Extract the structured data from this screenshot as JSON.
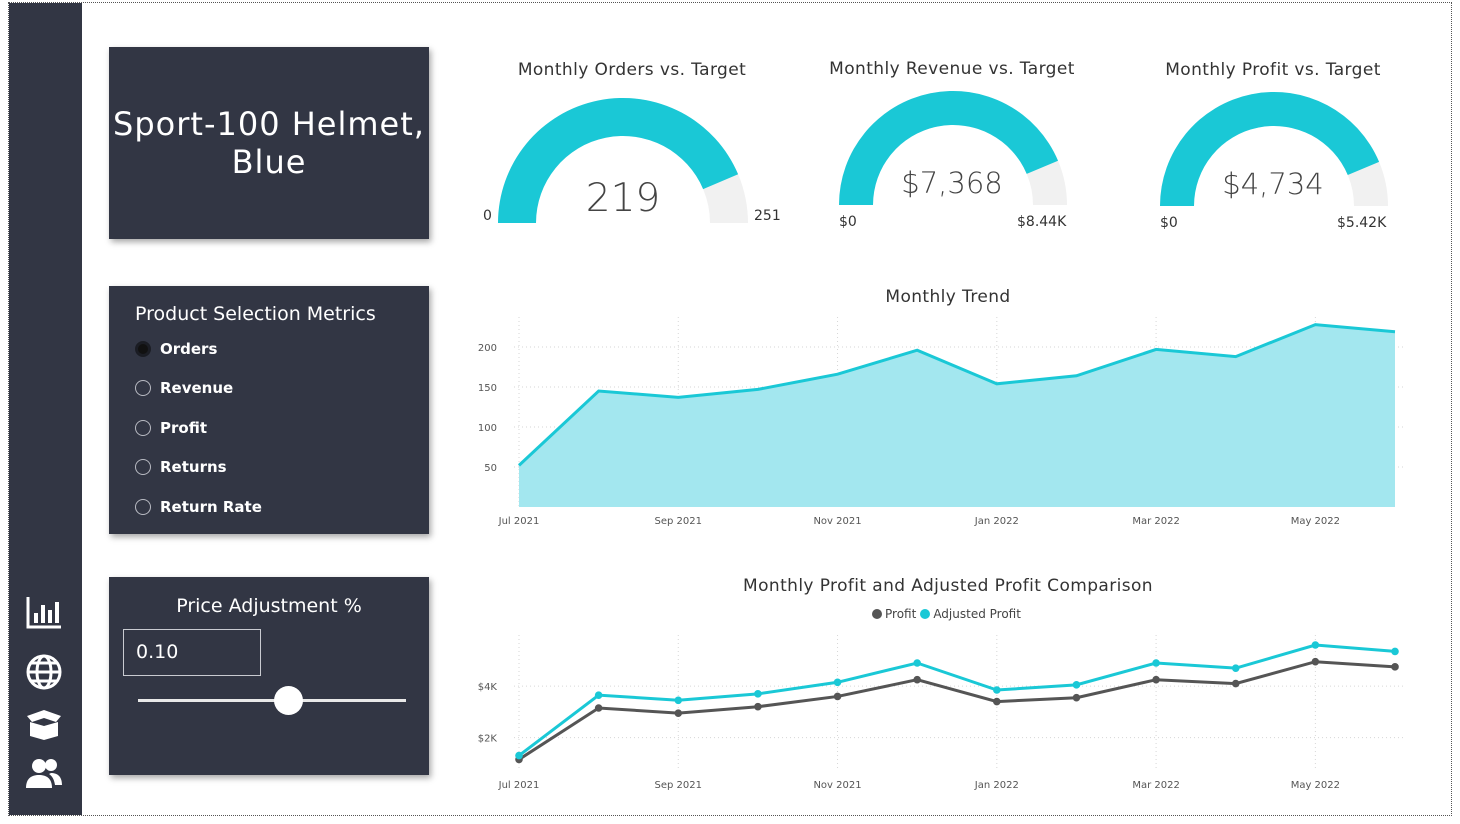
{
  "product": {
    "title": "Sport-100 Helmet, Blue"
  },
  "nav": [
    {
      "name": "chart-bar-icon"
    },
    {
      "name": "globe-icon"
    },
    {
      "name": "box-icon"
    },
    {
      "name": "users-icon"
    }
  ],
  "metrics": {
    "title": "Product Selection Metrics",
    "options": [
      {
        "label": "Orders",
        "selected": true
      },
      {
        "label": "Revenue",
        "selected": false
      },
      {
        "label": "Profit",
        "selected": false
      },
      {
        "label": "Returns",
        "selected": false
      },
      {
        "label": "Return Rate",
        "selected": false
      }
    ]
  },
  "price": {
    "title": "Price Adjustment %",
    "value": "0.10",
    "slider_fraction": 0.56
  },
  "gauges": [
    {
      "title": "Monthly Orders vs. Target",
      "value_label": "219",
      "min_label": "0",
      "max_label": "251",
      "value": 219,
      "target": 251
    },
    {
      "title": "Monthly Revenue vs. Target",
      "value_label": "$7,368",
      "min_label": "$0",
      "max_label": "$8.44K",
      "value": 7368,
      "target": 8440
    },
    {
      "title": "Monthly Profit vs. Target",
      "value_label": "$4,734",
      "min_label": "$0",
      "max_label": "$5.42K",
      "value": 4734,
      "target": 5420
    }
  ],
  "colors": {
    "accent": "#1ac8d6",
    "area_fill": "#a3e7ef",
    "profit": "#555555",
    "gauge_bg": "#f1f1f1",
    "panel": "#323644"
  },
  "chart_data": [
    {
      "type": "area",
      "title": "Monthly Trend",
      "x": [
        "2021-07",
        "2021-08",
        "2021-09",
        "2021-10",
        "2021-11",
        "2021-12",
        "2022-01",
        "2022-02",
        "2022-03",
        "2022-04",
        "2022-05",
        "2022-06"
      ],
      "xticks": [
        "Jul 2021",
        "Sep 2021",
        "Nov 2021",
        "Jan 2022",
        "Mar 2022",
        "May 2022"
      ],
      "yticks": [
        50,
        100,
        150,
        200
      ],
      "ylim": [
        0,
        230
      ],
      "series": [
        {
          "values": [
            52,
            145,
            137,
            147,
            166,
            196,
            154,
            164,
            197,
            188,
            228,
            219
          ]
        }
      ],
      "grid": true
    },
    {
      "type": "line",
      "title": "Monthly Profit and Adjusted Profit Comparison",
      "x": [
        "2021-07",
        "2021-08",
        "2021-09",
        "2021-10",
        "2021-11",
        "2021-12",
        "2022-01",
        "2022-02",
        "2022-03",
        "2022-04",
        "2022-05",
        "2022-06"
      ],
      "xticks": [
        "Jul 2021",
        "Sep 2021",
        "Nov 2021",
        "Jan 2022",
        "Mar 2022",
        "May 2022"
      ],
      "yticks": [
        "$2K",
        "$4K"
      ],
      "ytick_values": [
        2000,
        4000
      ],
      "ylim": [
        700,
        5600
      ],
      "legend_placement": "top-center",
      "series": [
        {
          "name": "Profit",
          "values": [
            1150,
            3150,
            2950,
            3200,
            3600,
            4250,
            3400,
            3550,
            4250,
            4100,
            4950,
            4750
          ]
        },
        {
          "name": "Adjusted Profit",
          "values": [
            1300,
            3650,
            3450,
            3700,
            4150,
            4900,
            3850,
            4050,
            4900,
            4700,
            5600,
            5350
          ]
        }
      ],
      "grid": true
    }
  ]
}
